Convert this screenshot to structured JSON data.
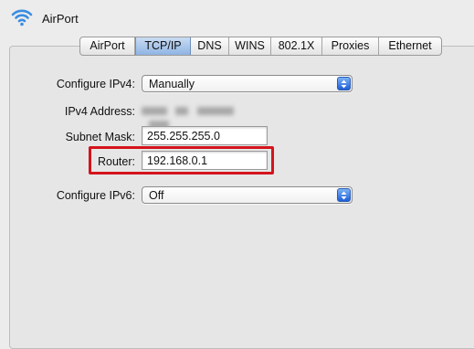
{
  "window": {
    "title": "AirPort",
    "icon": "wifi-icon"
  },
  "tabs": [
    {
      "label": "AirPort",
      "active": false
    },
    {
      "label": "TCP/IP",
      "active": true
    },
    {
      "label": "DNS",
      "active": false
    },
    {
      "label": "WINS",
      "active": false
    },
    {
      "label": "802.1X",
      "active": false
    },
    {
      "label": "Proxies",
      "active": false
    },
    {
      "label": "Ethernet",
      "active": false
    }
  ],
  "form": {
    "configure_ipv4": {
      "label": "Configure IPv4:",
      "value": "Manually"
    },
    "ipv4_address": {
      "label": "IPv4 Address:",
      "value_obscured": true
    },
    "subnet_mask": {
      "label": "Subnet Mask:",
      "value": "255.255.255.0"
    },
    "router": {
      "label": "Router:",
      "value": "192.168.0.1",
      "highlighted": true
    },
    "configure_ipv6": {
      "label": "Configure IPv6:",
      "value": "Off"
    }
  },
  "colors": {
    "highlight": "#d4141c",
    "wifi": "#3a8de0",
    "popup_arrow": "#1f5ed6"
  }
}
